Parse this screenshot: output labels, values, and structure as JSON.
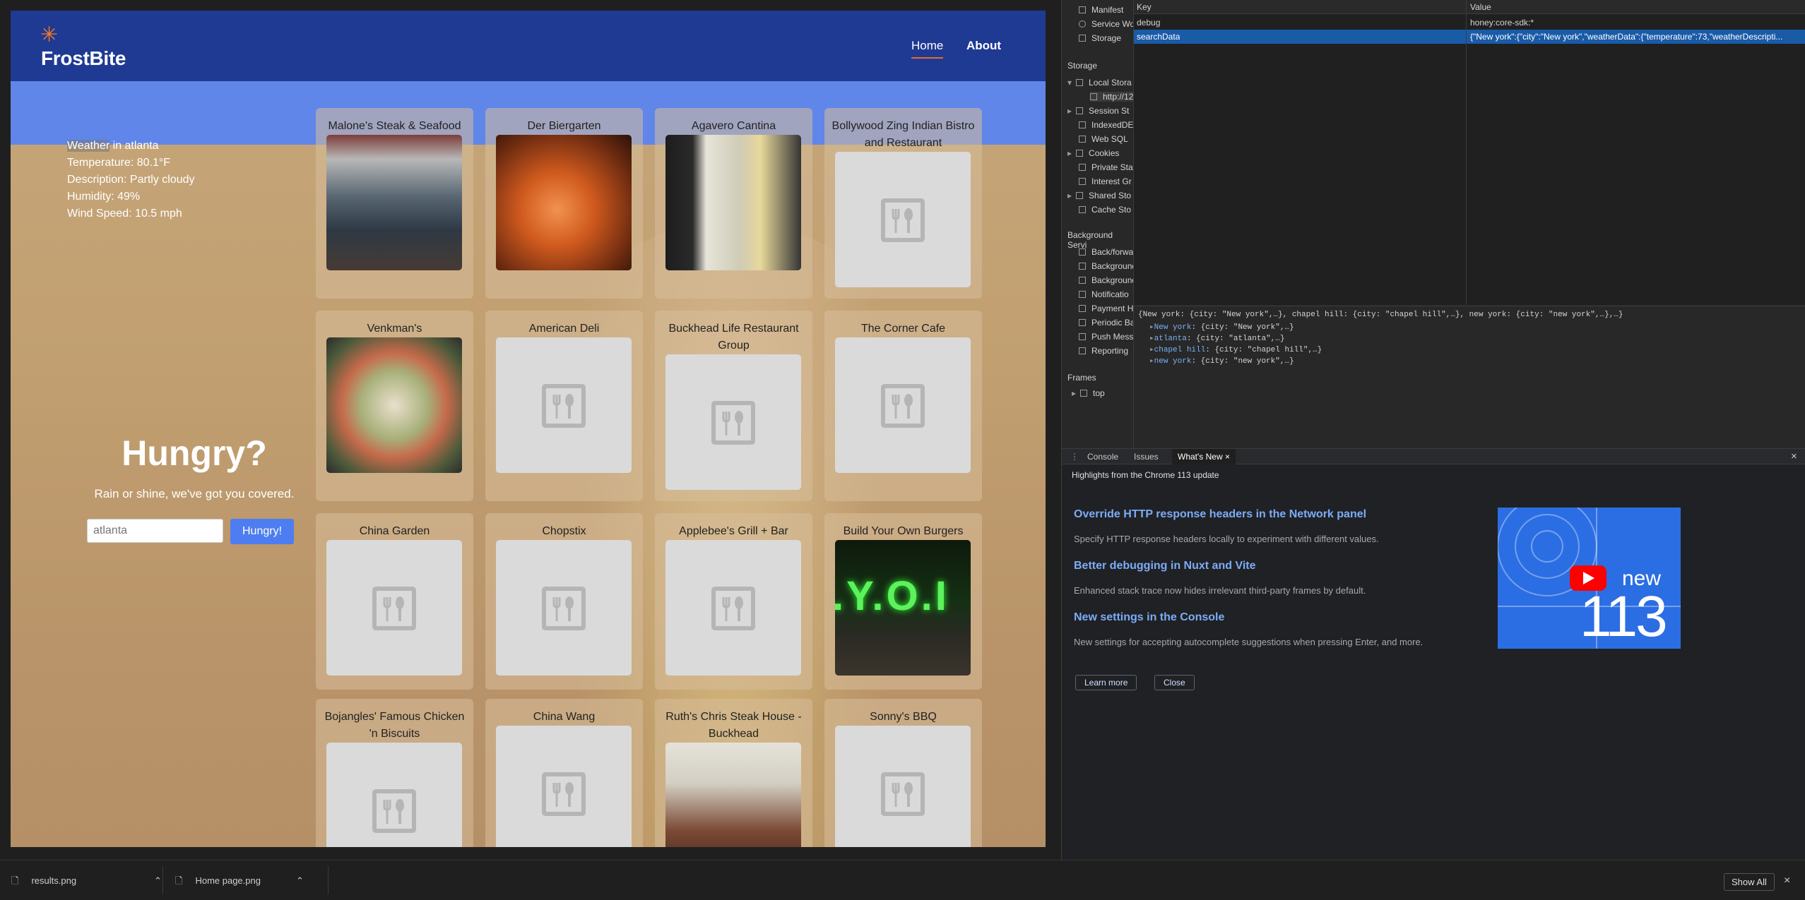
{
  "app": {
    "brand": "FrostBite",
    "nav": {
      "home": "Home",
      "about": "About"
    },
    "weather": {
      "heading_word": "Weather",
      "heading_rest": " in atlanta",
      "temperature": "Temperature: 80.1°F",
      "description": "Description: Partly cloudy",
      "humidity": "Humidity: 49%",
      "wind": "Wind Speed: 10.5 mph"
    },
    "hero": {
      "title": "Hungry?",
      "tagline": "Rain or shine, we've got you covered."
    },
    "search": {
      "placeholder": "atlanta",
      "button": "Hungry!"
    },
    "restaurants": [
      {
        "name": "Malone's Steak & Seafood",
        "image": "photo-storefront"
      },
      {
        "name": "Der Biergarten",
        "image": "photo-beer"
      },
      {
        "name": "Agavero Cantina",
        "image": "photo-cans"
      },
      {
        "name": "Bollywood Zing Indian Bistro and Restaurant",
        "image": "placeholder"
      },
      {
        "name": "Venkman's",
        "image": "photo-salad"
      },
      {
        "name": "American Deli",
        "image": "placeholder"
      },
      {
        "name": "Buckhead Life Restaurant Group",
        "image": "placeholder"
      },
      {
        "name": "The Corner Cafe",
        "image": "placeholder"
      },
      {
        "name": "China Garden",
        "image": "placeholder"
      },
      {
        "name": "Chopstix",
        "image": "placeholder"
      },
      {
        "name": "Applebee's Grill + Bar",
        "image": "placeholder"
      },
      {
        "name": "Build Your Own Burgers",
        "image": "photo-sign",
        "sign_text": ".Y.O.I"
      },
      {
        "name": "Bojangles' Famous Chicken 'n Biscuits",
        "image": "placeholder"
      },
      {
        "name": "China Wang",
        "image": "placeholder"
      },
      {
        "name": "Ruth's Chris Steak House - Buckhead",
        "image": "photo-steak"
      },
      {
        "name": "Sonny's BBQ",
        "image": "placeholder"
      }
    ]
  },
  "devtools": {
    "sidebar_top": [
      "Manifest",
      "Service Wo",
      "Storage"
    ],
    "storage_heading": "Storage",
    "storage_items": [
      "Local Stora",
      "http://12",
      "Session St",
      "IndexedDE",
      "Web SQL",
      "Cookies",
      "Private Sta",
      "Interest Gr",
      "Shared Sto",
      "Cache Sto"
    ],
    "background_heading": "Background Servi",
    "background_items": [
      "Back/forwa",
      "Background",
      "Background",
      "Notificatio",
      "Payment H",
      "Periodic Ba",
      "Push Mess",
      "Reporting"
    ],
    "frames_heading": "Frames",
    "frames_item": "top",
    "table": {
      "headers": {
        "key": "Key",
        "value": "Value"
      },
      "rows": [
        {
          "key": "debug",
          "value": "honey:core-sdk:*"
        },
        {
          "key": "searchData",
          "value": "{\"New york\":{\"city\":\"New york\",\"weatherData\":{\"temperature\":73,\"weatherDescripti..."
        }
      ]
    },
    "preview": {
      "root": "{New york: {city: \"New york\",…}, chapel hill: {city: \"chapel hill\",…}, new york: {city: \"new york\",…},…}",
      "entries": [
        {
          "key": "New york",
          "val": ": {city: \"New york\",…}"
        },
        {
          "key": "atlanta",
          "val": ": {city: \"atlanta\",…}"
        },
        {
          "key": "chapel hill",
          "val": ": {city: \"chapel hill\",…}"
        },
        {
          "key": "new york",
          "val": ": {city: \"new york\",…}"
        }
      ]
    },
    "drawer": {
      "tabs": [
        "Console",
        "Issues",
        "What's New"
      ],
      "highlight": "Highlights from the Chrome 113 update",
      "items": [
        {
          "title": "Override HTTP response headers in the Network panel",
          "desc": "Specify HTTP response headers locally to experiment with different values."
        },
        {
          "title": "Better debugging in Nuxt and Vite",
          "desc": "Enhanced stack trace now hides irrelevant third-party frames by default."
        },
        {
          "title": "New settings in the Console",
          "desc": "New settings for accepting autocomplete suggestions when pressing Enter, and more."
        }
      ],
      "video": {
        "label": "new",
        "number": "113"
      },
      "learn_more": "Learn more",
      "close": "Close"
    }
  },
  "downloads": {
    "items": [
      "results.png",
      "Home page.png"
    ],
    "show_all": "Show All"
  },
  "colors": {
    "nav": "#1f3a93",
    "accent": "#e86a2b",
    "button": "#4d7df0",
    "sky": "#5f86e8"
  }
}
